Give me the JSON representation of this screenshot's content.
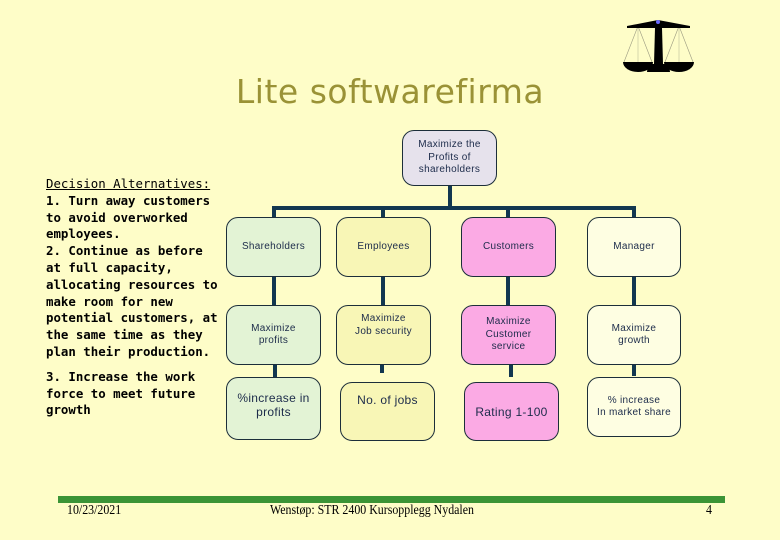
{
  "slide": {
    "title": "Lite softwarefirma",
    "logo_icon": "scales-of-justice-icon"
  },
  "alternatives": {
    "heading": "Decision Alternatives:",
    "item1": "1. Turn away customers to avoid overworked employees.",
    "item2": "2. Continue as before at full capacity, allocating resources to make room for new potential customers, at the same time as they plan their production.",
    "item3": "3. Increase the work force to meet future growth"
  },
  "hierarchy": {
    "root": "Maximize the\nProfits of\nshareholders",
    "branches": [
      {
        "stakeholder": "Shareholders",
        "objective": "Maximize\nprofits",
        "measure": "%increase in\nprofits",
        "color": "#e3f3d5"
      },
      {
        "stakeholder": "Employees",
        "objective": "Maximize\nJob security",
        "measure": "No. of jobs",
        "color": "#f8f6b6"
      },
      {
        "stakeholder": "Customers",
        "objective": "Maximize\nCustomer\nservice",
        "measure": "Rating 1-100",
        "color": "#fbaae4"
      },
      {
        "stakeholder": "Manager",
        "objective": "Maximize\ngrowth",
        "measure": "% increase\nIn market share",
        "color": "#fefee2"
      }
    ]
  },
  "footer": {
    "date": "10/23/2021",
    "center": "Wenstøp: STR 2400 Kursopplegg Nydalen",
    "page": "4"
  },
  "colors": {
    "background": "#fefdc8",
    "title": "#9a9236",
    "connector": "#123750",
    "rule": "#3b9436"
  }
}
